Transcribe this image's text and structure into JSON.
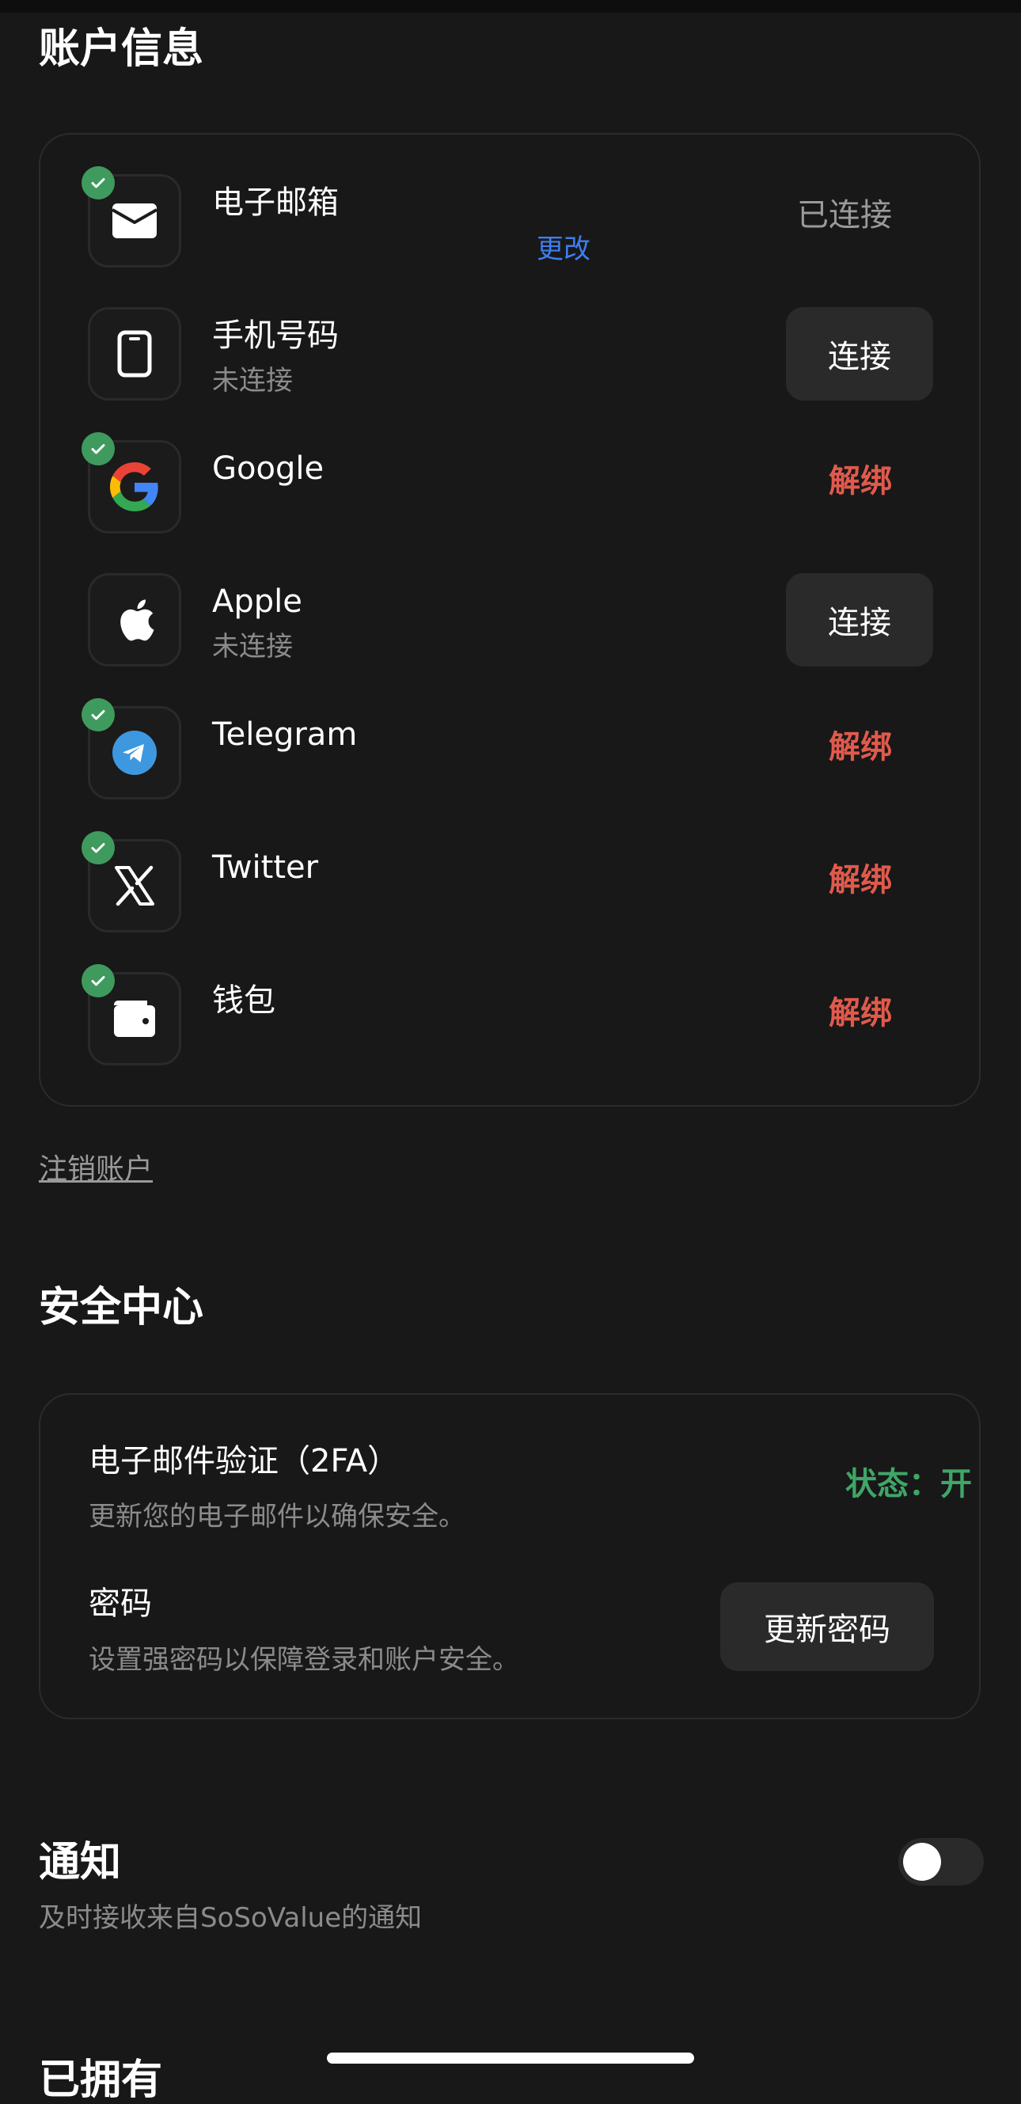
{
  "account_section": {
    "title": "账户信息",
    "rows": [
      {
        "name": "电子邮箱",
        "sub": "",
        "status": "已连接",
        "change_label": "更改",
        "verified": true,
        "icon": "envelope-icon"
      },
      {
        "name": "手机号码",
        "sub": "未连接",
        "action_label": "连接",
        "verified": false,
        "icon": "phone-icon"
      },
      {
        "name": "Google",
        "sub": "",
        "action_label": "解绑",
        "verified": true,
        "icon": "google-icon"
      },
      {
        "name": "Apple",
        "sub": "未连接",
        "action_label": "连接",
        "verified": false,
        "icon": "apple-icon"
      },
      {
        "name": "Telegram",
        "sub": "",
        "action_label": "解绑",
        "verified": true,
        "icon": "telegram-icon"
      },
      {
        "name": "Twitter",
        "sub": "",
        "action_label": "解绑",
        "verified": true,
        "icon": "x-icon"
      },
      {
        "name": "钱包",
        "sub": "",
        "action_label": "解绑",
        "verified": true,
        "icon": "wallet-icon"
      }
    ],
    "delete_account_label": "注销账户"
  },
  "security_section": {
    "title": "安全中心",
    "twofa_title": "电子邮件验证（2FA）",
    "twofa_desc": "更新您的电子邮件以确保安全。",
    "twofa_status": "状态：开",
    "password_title": "密码",
    "password_desc": "设置强密码以保障登录和账户安全。",
    "password_button": "更新密码"
  },
  "notify_section": {
    "title": "通知",
    "desc": "及时接收来自SoSoValue的通知",
    "toggle_on": false
  },
  "next_section": {
    "title": "已拥有"
  },
  "colors": {
    "background": "#181818",
    "verified_badge": "#3f9a5d",
    "unbind": "#e05a4c",
    "link_blue": "#3e7ef0",
    "status_green": "#3fa667"
  }
}
